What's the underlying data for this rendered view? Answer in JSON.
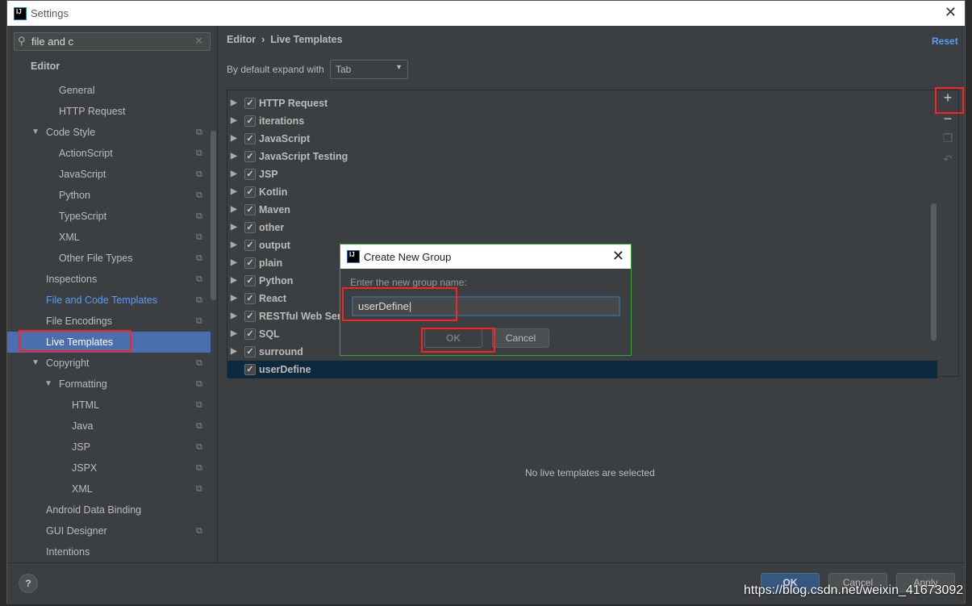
{
  "window": {
    "title": "Settings"
  },
  "search": {
    "value": "file and c"
  },
  "sidebar": {
    "items": [
      {
        "label": "Editor",
        "level": 0,
        "bold": true
      },
      {
        "label": "General",
        "level": 2
      },
      {
        "label": "HTTP Request",
        "level": 2
      },
      {
        "label": "Code Style",
        "level": 1,
        "expanded": true,
        "copy": true
      },
      {
        "label": "ActionScript",
        "level": 2,
        "copy": true
      },
      {
        "label": "JavaScript",
        "level": 2,
        "copy": true
      },
      {
        "label": "Python",
        "level": 2,
        "copy": true
      },
      {
        "label": "TypeScript",
        "level": 2,
        "copy": true
      },
      {
        "label": "XML",
        "level": 2,
        "copy": true
      },
      {
        "label": "Other File Types",
        "level": 2,
        "copy": true
      },
      {
        "label": "Inspections",
        "level": 1,
        "copy": true
      },
      {
        "label": "File and Code Templates",
        "level": 1,
        "copy": true,
        "link": true
      },
      {
        "label": "File Encodings",
        "level": 1,
        "copy": true
      },
      {
        "label": "Live Templates",
        "level": 1,
        "selected": true
      },
      {
        "label": "Copyright",
        "level": 1,
        "expanded": true,
        "copy": true
      },
      {
        "label": "Formatting",
        "level": 2,
        "expanded": true,
        "copy": true
      },
      {
        "label": "HTML",
        "level": 3,
        "copy": true
      },
      {
        "label": "Java",
        "level": 3,
        "copy": true
      },
      {
        "label": "JSP",
        "level": 3,
        "copy": true
      },
      {
        "label": "JSPX",
        "level": 3,
        "copy": true
      },
      {
        "label": "XML",
        "level": 3,
        "copy": true
      },
      {
        "label": "Android Data Binding",
        "level": 1
      },
      {
        "label": "GUI Designer",
        "level": 1,
        "copy": true
      },
      {
        "label": "Intentions",
        "level": 1
      }
    ]
  },
  "breadcrumb": {
    "parent": "Editor",
    "sep": "›",
    "current": "Live Templates"
  },
  "reset_label": "Reset",
  "expand": {
    "label": "By default expand with",
    "value": "Tab"
  },
  "templates": [
    {
      "label": "HTTP Request"
    },
    {
      "label": "iterations"
    },
    {
      "label": "JavaScript"
    },
    {
      "label": "JavaScript Testing"
    },
    {
      "label": "JSP"
    },
    {
      "label": "Kotlin"
    },
    {
      "label": "Maven"
    },
    {
      "label": "other"
    },
    {
      "label": "output"
    },
    {
      "label": "plain"
    },
    {
      "label": "Python"
    },
    {
      "label": "React"
    },
    {
      "label": "RESTful Web Services"
    },
    {
      "label": "SQL"
    },
    {
      "label": "surround"
    },
    {
      "label": "userDefine",
      "selected": true,
      "noArrow": true
    }
  ],
  "empty_text": "No live templates are selected",
  "footer": {
    "help": "?",
    "ok": "OK",
    "cancel": "Cancel",
    "apply": "Apply"
  },
  "dialog": {
    "title": "Create New Group",
    "prompt": "Enter the new group name:",
    "value": "userDefine",
    "ok": "OK",
    "cancel": "Cancel"
  },
  "watermark": "https://blog.csdn.net/weixin_41673092",
  "colors": {
    "selection": "#4b6eaf",
    "link": "#589df6",
    "highlight": "#ff2222",
    "dialog_border": "#36a834"
  }
}
